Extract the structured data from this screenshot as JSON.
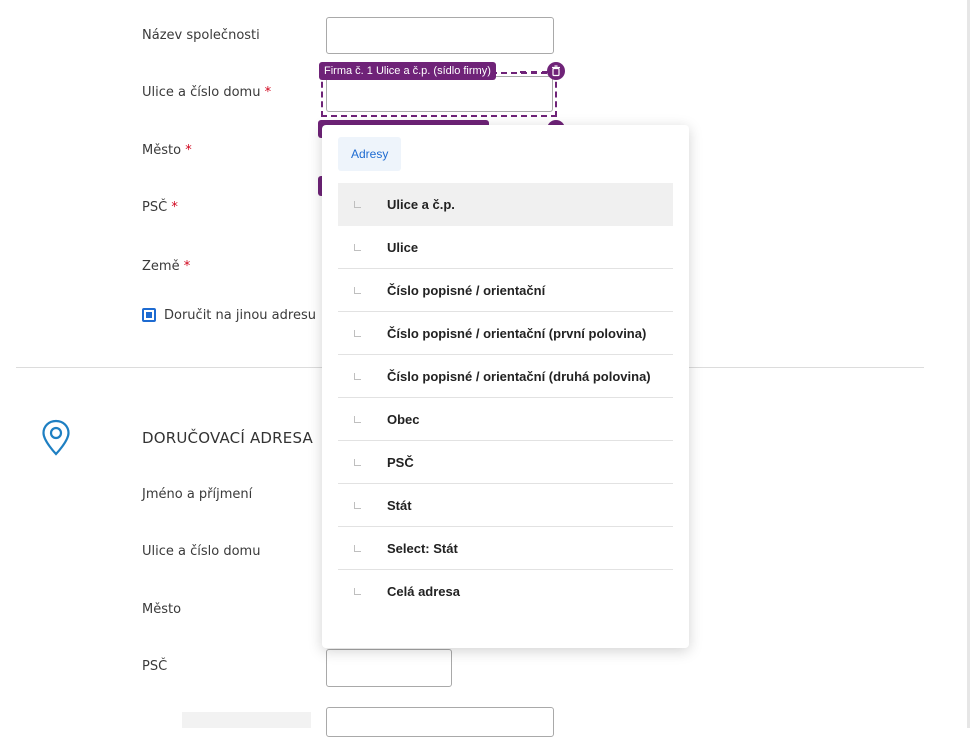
{
  "form": {
    "company_name_label": "Název společnosti",
    "street_label": "Ulice a číslo domu",
    "city_label": "Město",
    "zip_label": "PSČ",
    "country_label": "Země",
    "required_mark": "*",
    "deliver_other_label": "Doručit na jinou adresu",
    "deliver_other_checked": true
  },
  "delivery": {
    "title": "DORUČOVACÍ ADRESA",
    "name_label": "Jméno a příjmení",
    "street_label": "Ulice a číslo domu",
    "city_label": "Město",
    "zip_label": "PSČ"
  },
  "mapping": {
    "tag_label": "Firma č. 1 Ulice a č.p. (sídlo firmy)",
    "accent_color": "#6f2378"
  },
  "dropdown": {
    "tab_label": "Adresy",
    "items": [
      {
        "label": "Ulice a č.p.",
        "active": true
      },
      {
        "label": "Ulice"
      },
      {
        "label": "Číslo popisné / orientační"
      },
      {
        "label": "Číslo popisné / orientační (první polovina)"
      },
      {
        "label": "Číslo popisné / orientační (druhá polovina)"
      },
      {
        "label": "Obec"
      },
      {
        "label": "PSČ"
      },
      {
        "label": "Stát"
      },
      {
        "label": "Select: Stát"
      },
      {
        "label": "Celá adresa"
      }
    ]
  },
  "icons": {
    "pin": "map-pin-icon",
    "trash": "trash-icon",
    "corner": "corner-arrow-icon"
  }
}
